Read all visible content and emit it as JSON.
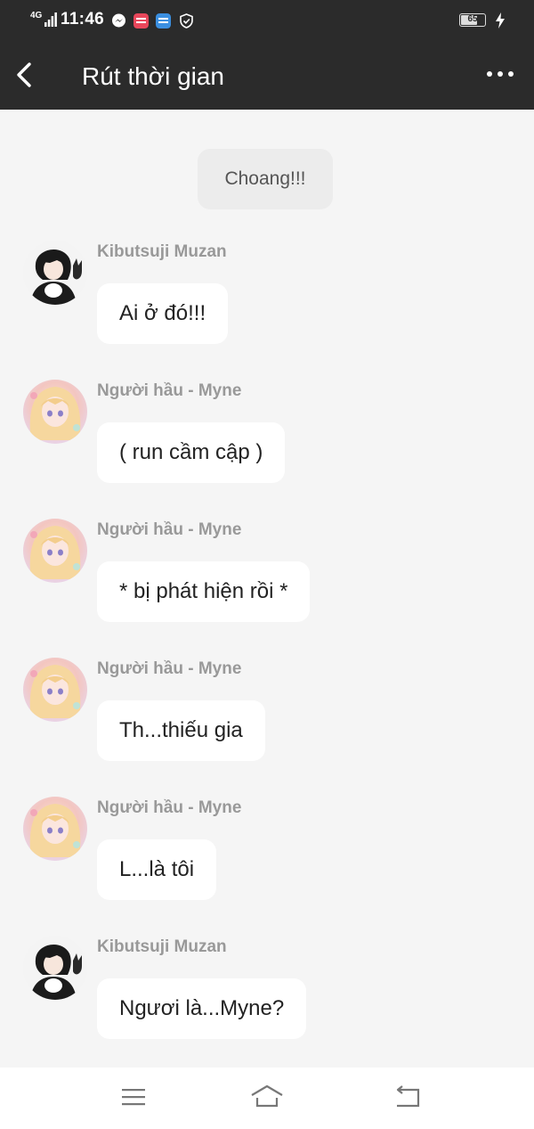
{
  "status_bar": {
    "network": "4G",
    "time": "11:46",
    "battery": "65",
    "battery_level": 0.65,
    "icons": [
      "messenger-icon",
      "manga-toon-icon",
      "novel-toon-icon",
      "shield-icon"
    ]
  },
  "app_bar": {
    "title": "Rút thời gian"
  },
  "chat": {
    "system_message": "Choang!!!",
    "messages": [
      {
        "sender": "Kibutsuji Muzan",
        "text": "Ai ở đó!!!",
        "avatar": "muzan-avatar"
      },
      {
        "sender": "Người hầu - Myne",
        "text": "( run cầm cập )",
        "avatar": "myne-avatar"
      },
      {
        "sender": "Người hầu - Myne",
        "text": "* bị phát hiện rồi *",
        "avatar": "myne-avatar"
      },
      {
        "sender": "Người hầu - Myne",
        "text": "Th...thiếu gia",
        "avatar": "myne-avatar"
      },
      {
        "sender": "Người hầu - Myne",
        "text": "L...là tôi",
        "avatar": "myne-avatar"
      },
      {
        "sender": "Kibutsuji Muzan",
        "text": "Ngươi là...Myne?",
        "avatar": "muzan-avatar"
      }
    ]
  },
  "nav_bar": {
    "buttons": [
      "menu-icon",
      "home-icon",
      "back-nav-icon"
    ]
  },
  "colors": {
    "bar_background": "#2b2b2b",
    "chat_background": "#f5f5f5",
    "bubble_background": "#ffffff",
    "system_bubble_background": "#ececec",
    "sender_name": "#999999"
  }
}
